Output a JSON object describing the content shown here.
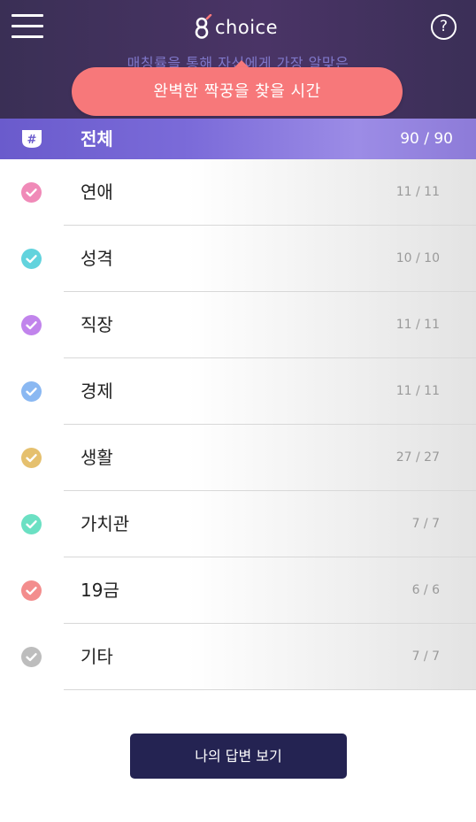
{
  "header": {
    "logo_text": "choice",
    "subtitle": "매칭률을 통해 자신에게 가장 알맞은",
    "help_label": "?"
  },
  "tooltip": {
    "text": "완벽한 짝꿍을 찾을 시간"
  },
  "total": {
    "label": "전체",
    "count": "90 / 90",
    "icon": "hash-icon"
  },
  "categories": [
    {
      "label": "연애",
      "count": "11 / 11",
      "color": "#f08ab8"
    },
    {
      "label": "성격",
      "count": "10 / 10",
      "color": "#62d3dd"
    },
    {
      "label": "직장",
      "count": "11 / 11",
      "color": "#c184ec"
    },
    {
      "label": "경제",
      "count": "11 / 11",
      "color": "#8ab8f2"
    },
    {
      "label": "생활",
      "count": "27 / 27",
      "color": "#e5c06e"
    },
    {
      "label": "가치관",
      "count": "7 / 7",
      "color": "#6be0c3"
    },
    {
      "label": "19금",
      "count": "6 / 6",
      "color": "#f38d8d"
    },
    {
      "label": "기타",
      "count": "7 / 7",
      "color": "#bdbdbd"
    }
  ],
  "footer": {
    "button_label": "나의 답변 보기"
  }
}
